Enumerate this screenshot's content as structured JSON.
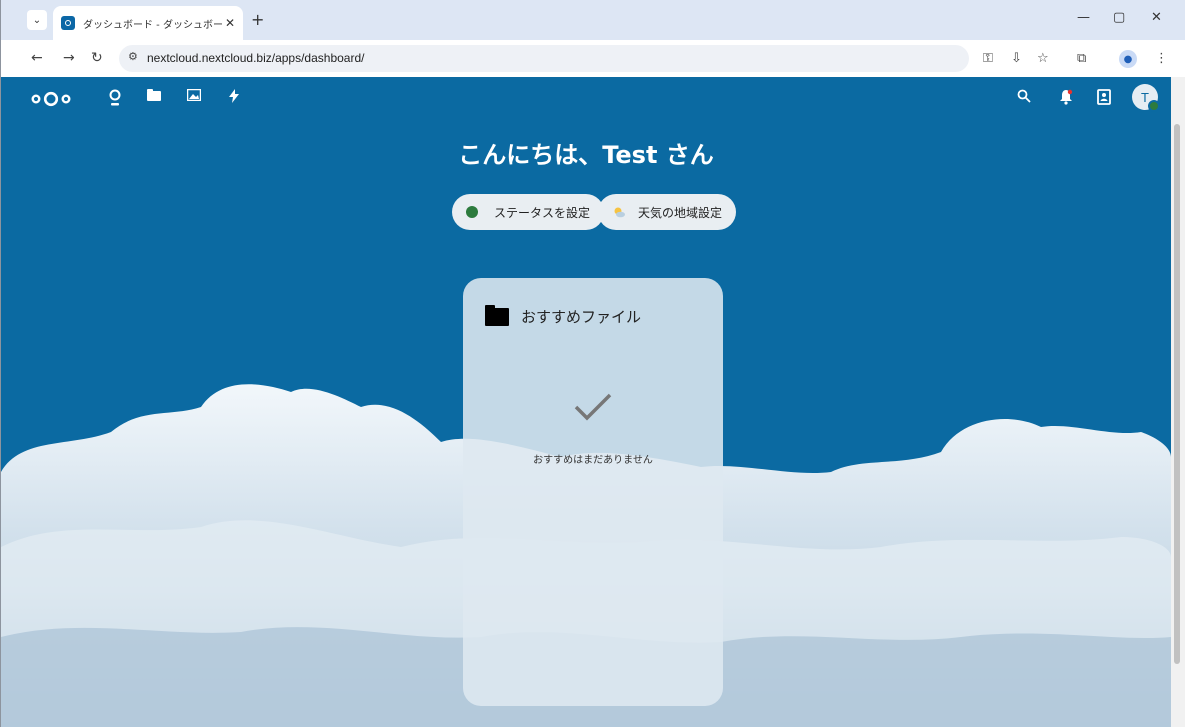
{
  "browser": {
    "tab_title": "ダッシュボード - ダッシュボード - Next",
    "url": "nextcloud.nextcloud.biz/apps/dashboard/",
    "new_tab": "+",
    "tab_close": "✕",
    "minimize": "—",
    "maximize": "▢",
    "close": "✕"
  },
  "nextcloud": {
    "greeting": "こんにちは、Test さん",
    "status_button": "ステータスを設定",
    "weather_button": "天気の地域設定",
    "avatar_letter": "T",
    "widget": {
      "title": "おすすめファイル",
      "empty_text": "おすすめはまだありません"
    }
  },
  "colors": {
    "header_bg": "#0b6aa2",
    "status_online": "#2d7b3e"
  }
}
